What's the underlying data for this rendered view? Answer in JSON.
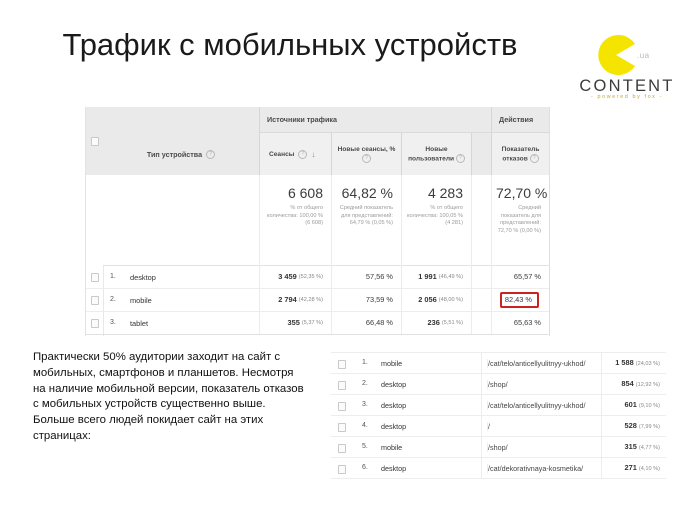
{
  "slide": {
    "title": "Трафик с мобильных устройств",
    "body_text": "Практически 50% аудитории заходит на сайт с мобильных, смартфонов и планшетов. Несмотря на наличие мобильной версии, показатель отказов с мобильных устройств существенно выше. Больше всего людей покидает сайт на этих страницах:"
  },
  "logo": {
    "mark_color": "#f5e400",
    "ua": ".ua",
    "wordmark": "CONTENT",
    "tagline": "- powered by fox -"
  },
  "device_table": {
    "group_headers": {
      "traffic_sources": "Источники трафика",
      "actions": "Действия"
    },
    "dimension_header": "Тип устройства",
    "columns": [
      {
        "label": "Сеансы",
        "has_help": true,
        "sorted": true
      },
      {
        "label": "Новые сеансы, %",
        "has_help": true,
        "sorted": false
      },
      {
        "label": "Новые пользователи",
        "has_help": true,
        "sorted": false
      },
      {
        "label": "Показатель отказов",
        "has_help": true,
        "sorted": false
      }
    ],
    "summary": [
      {
        "big": "6 608",
        "sub": "% от общего количества: 100,00 % (6 608)"
      },
      {
        "big": "64,82 %",
        "sub": "Средний показатель для представлений: 64,79 % (0,05 %)"
      },
      {
        "big": "4 283",
        "sub": "% от общего количества: 100,05 % (4 281)"
      },
      {
        "big": "72,70 %",
        "sub": "Средний показатель для представлений: 72,70 % (0,00 %)"
      }
    ],
    "rows": [
      {
        "num": "1.",
        "name": "desktop",
        "sessions": "3 459",
        "sessions_pct": "(52,35 %)",
        "new_sessions": "57,56 %",
        "new_users": "1 991",
        "new_users_pct": "(46,49 %)",
        "bounce": "65,57 %",
        "highlighted": false
      },
      {
        "num": "2.",
        "name": "mobile",
        "sessions": "2 794",
        "sessions_pct": "(42,28 %)",
        "new_sessions": "73,59 %",
        "new_users": "2 056",
        "new_users_pct": "(48,00 %)",
        "bounce": "82,43 %",
        "highlighted": true
      },
      {
        "num": "3.",
        "name": "tablet",
        "sessions": "355",
        "sessions_pct": "(5,37 %)",
        "new_sessions": "66,48 %",
        "new_users": "236",
        "new_users_pct": "(5,51 %)",
        "bounce": "65,63 %",
        "highlighted": false
      }
    ],
    "highlight_color": "#cc2222"
  },
  "pages_table": {
    "rows": [
      {
        "num": "1.",
        "device": "mobile",
        "url": "/cat/telo/anticellyulitnyy-ukhod/",
        "value": "1 588",
        "pct": "(24,03 %)"
      },
      {
        "num": "2.",
        "device": "desktop",
        "url": "/shop/",
        "value": "854",
        "pct": "(12,92 %)"
      },
      {
        "num": "3.",
        "device": "desktop",
        "url": "/cat/telo/anticellyulitnyy-ukhod/",
        "value": "601",
        "pct": "(9,10 %)"
      },
      {
        "num": "4.",
        "device": "desktop",
        "url": "/",
        "value": "528",
        "pct": "(7,99 %)"
      },
      {
        "num": "5.",
        "device": "mobile",
        "url": "/shop/",
        "value": "315",
        "pct": "(4,77 %)"
      },
      {
        "num": "6.",
        "device": "desktop",
        "url": "/cat/dekorativnaya-kosmetika/",
        "value": "271",
        "pct": "(4,10 %)"
      }
    ]
  }
}
